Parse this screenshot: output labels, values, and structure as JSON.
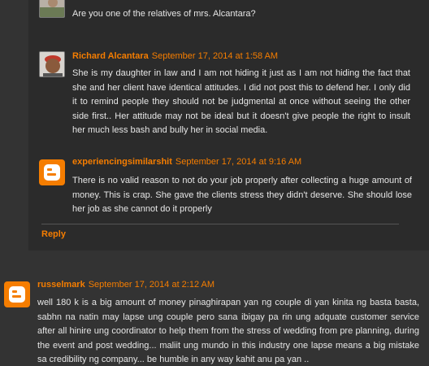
{
  "comments": [
    {
      "author": "",
      "timestamp": "",
      "text": "Are you one of the relatives of mrs. Alcantara?"
    },
    {
      "author": "Richard Alcantara",
      "timestamp": "September 17, 2014 at 1:58 AM",
      "text": "She is my daughter in law and I am not hiding it just as I am not hiding the fact that she and her client have identical attitudes. I did not post this to defend her. I only did it to remind people they should not be judgmental at once without seeing the other side first.. Her attitude may not be ideal but it doesn't give people the right to insult her much less bash and bully her in social media."
    },
    {
      "author": "experiencingsimilarshit",
      "timestamp": "September 17, 2014 at 9:16 AM",
      "text": "There is no valid reason to not do your job properly after collecting a huge amount of money. This is crap. She gave the clients stress they didn't deserve. She should lose her job as she cannot do it properly"
    },
    {
      "author": "russelmark",
      "timestamp": "September 17, 2014 at 2:12 AM",
      "text": "well 180 k is a big amount of money pinaghirapan yan ng couple di yan kinita ng basta basta, sabhn na natin may lapse ung couple pero sana ibigay pa rin ung adquate customer service after all hinire ung coordinator to help them from the stress of wedding from pre planning, during the event and post wedding... maliit ung mundo in this industry one lapse means a big mistake sa credibility ng company... be humble in any way kahit anu pa yan .."
    }
  ],
  "reply": {
    "label": "Reply"
  },
  "icons": {
    "blogger": "blogger-icon",
    "avatar": "profile-photo"
  },
  "colors": {
    "accent": "#f57d00",
    "background": "#333333",
    "thread_background": "#2b2b2b"
  }
}
